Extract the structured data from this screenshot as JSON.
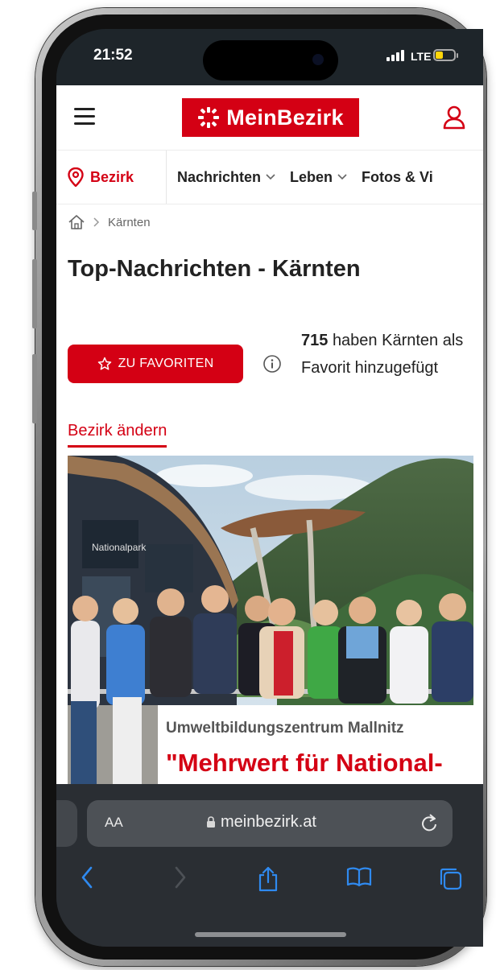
{
  "status_bar": {
    "time": "21:52",
    "network": "LTE",
    "battery_level": 0.4
  },
  "header": {
    "logo_text": "MeinBezirk",
    "brand_color": "#d40014",
    "menu_icon": "hamburger-icon",
    "account_icon": "user-icon"
  },
  "nav": {
    "district_label": "Bezirk",
    "items": [
      {
        "label": "Nachrichten"
      },
      {
        "label": "Leben"
      },
      {
        "label": "Fotos & Vi"
      }
    ]
  },
  "breadcrumb": {
    "current": "Kärnten"
  },
  "page": {
    "title": "Top-Nachrichten - Kärnten",
    "favorite_button": "ZU FAVORITEN",
    "favorite_count": "715",
    "favorite_text": "haben Kärnten als Favorit hinzugefügt",
    "change_district": "Bezirk ändern"
  },
  "article": {
    "kicker": "Umweltbildungszentrum Mallnitz",
    "headline": "\"Mehrwert für National-park und Region schaffen\""
  },
  "browser": {
    "text_size_label": "AA",
    "url": "meinbezirk.at"
  }
}
